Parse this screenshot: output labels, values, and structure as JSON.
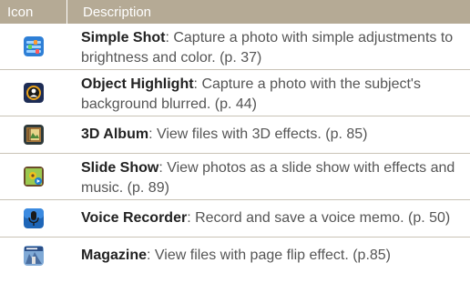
{
  "header": {
    "col_icon": "Icon",
    "col_description": "Description"
  },
  "rows": [
    {
      "icon": "simple-shot-icon",
      "title": "Simple Shot",
      "desc": ": Capture a photo with simple adjustments to brightness and color. (p. 37)"
    },
    {
      "icon": "object-highlight-icon",
      "title": "Object Highlight",
      "desc": ": Capture a photo with the subject's background blurred. (p. 44)"
    },
    {
      "icon": "3d-album-icon",
      "title": "3D Album",
      "desc": ": View files with 3D effects. (p. 85)"
    },
    {
      "icon": "slide-show-icon",
      "title": "Slide Show",
      "desc": ": View photos as a slide show with effects and music. (p. 89)"
    },
    {
      "icon": "voice-recorder-icon",
      "title": "Voice Recorder",
      "desc": ": Record and save a voice memo. (p. 50)"
    },
    {
      "icon": "magazine-icon",
      "title": "Magazine",
      "desc": ": View files with page flip effect. (p.85)"
    }
  ]
}
